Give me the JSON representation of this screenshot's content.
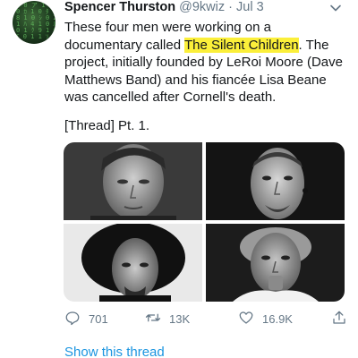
{
  "tweet": {
    "display_name": "Spencer Thurston",
    "handle": "@9kwiz",
    "separator": "·",
    "date": "Jul 3",
    "text_before": "These four men were working on a documentary called ",
    "text_highlight": "The Silent Children",
    "text_after": ". The project, initially founded by LeRoi Moore (Dave Matthews Band) and his fiancée Lisa Beane was cancelled after Cornell's death.",
    "thread_label": "[Thread] Pt. 1.",
    "highlight_color": "#fbef3a"
  },
  "actions": {
    "replies": "701",
    "retweets": "13K",
    "likes": "16.9K"
  },
  "show_thread": "Show this thread",
  "icons": {
    "reply": "reply-icon",
    "retweet": "retweet-icon",
    "like": "heart-icon",
    "share": "share-icon",
    "menu": "chevron-down-icon"
  },
  "colors": {
    "secondary_text": "#657786",
    "link": "#1b95e0"
  }
}
